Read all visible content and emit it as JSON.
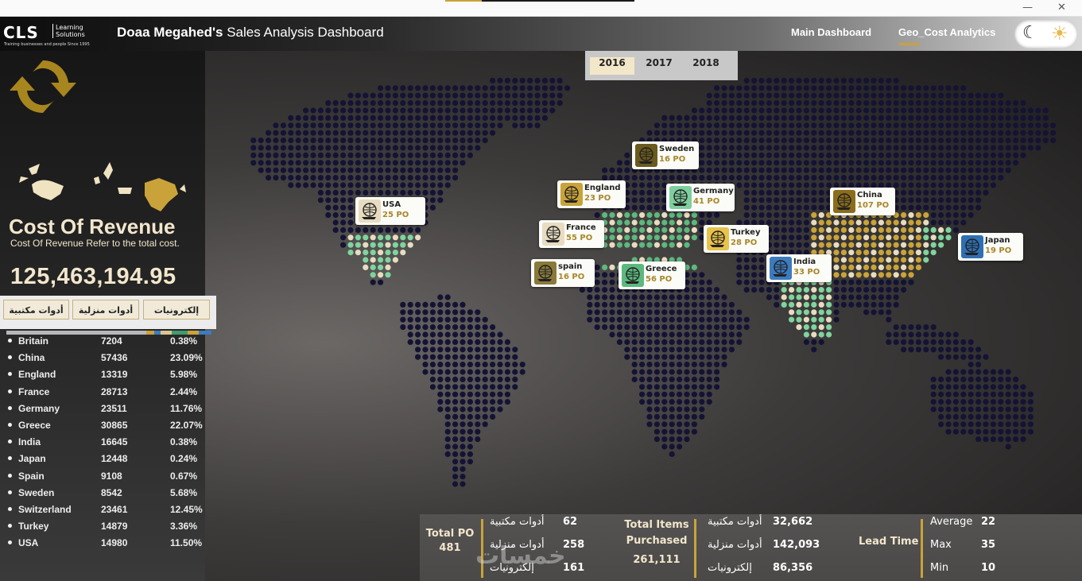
{
  "window": {
    "minimize": "—",
    "close": "✕"
  },
  "header": {
    "logo_text": "CLS",
    "logo_sub": "Learning Solutions",
    "logo_tagline": "Training businesses and people Since 1995",
    "title_owner": "Doaa Megahed's",
    "title_rest": " Sales Analysis Dashboard",
    "nav_main": "Main Dashboard",
    "nav_geo": "Geo_Cost Analytics"
  },
  "years": [
    "2016",
    "2017",
    "2018"
  ],
  "selected_year": "2016",
  "cost_of_revenue": {
    "title": "Cost Of Revenue",
    "subtitle": "Cost Of Revenue Refer to the total cost.",
    "value": "125,463,194.95"
  },
  "categories": [
    "أدوات مكتبية",
    "أدوات منزلية",
    "إلكترونيات"
  ],
  "category_strip_colors": [
    "#b7b7b7",
    "#c9a33a",
    "#3d7bbf",
    "#d8c58f",
    "#3f9b6d",
    "#c9a33a",
    "#3d7bbf"
  ],
  "table": [
    {
      "country": "Britain",
      "value": "7204",
      "pct": "0.38%"
    },
    {
      "country": "China",
      "value": "57436",
      "pct": "23.09%"
    },
    {
      "country": "England",
      "value": "13319",
      "pct": "5.98%"
    },
    {
      "country": "France",
      "value": "28713",
      "pct": "2.44%"
    },
    {
      "country": "Germany",
      "value": "23511",
      "pct": "11.76%"
    },
    {
      "country": "Greece",
      "value": "30865",
      "pct": "22.07%"
    },
    {
      "country": "India",
      "value": "16645",
      "pct": "0.38%"
    },
    {
      "country": "Japan",
      "value": "12448",
      "pct": "0.24%"
    },
    {
      "country": "Spain",
      "value": "9108",
      "pct": "0.67%"
    },
    {
      "country": "Sweden",
      "value": "8542",
      "pct": "5.68%"
    },
    {
      "country": "Switzerland",
      "value": "23461",
      "pct": "12.45%"
    },
    {
      "country": "Turkey",
      "value": "14879",
      "pct": "3.36%"
    },
    {
      "country": "USA",
      "value": "14980",
      "pct": "11.50%"
    }
  ],
  "markers": [
    {
      "name": "USA",
      "po": "25 PO",
      "color": "#e8dcc0"
    },
    {
      "name": "Sweden",
      "po": "16 PO",
      "color": "#6b5a1e"
    },
    {
      "name": "England",
      "po": "23 PO",
      "color": "#c9a33a"
    },
    {
      "name": "Germany",
      "po": "41 PO",
      "color": "#7fcf9e"
    },
    {
      "name": "France",
      "po": "55 PO",
      "color": "#e8dcc0"
    },
    {
      "name": "Turkey",
      "po": "28 PO",
      "color": "#e8c24a"
    },
    {
      "name": "spain",
      "po": "16 PO",
      "color": "#8a7a3a"
    },
    {
      "name": "Greece",
      "po": "56 PO",
      "color": "#5cb87e"
    },
    {
      "name": "China",
      "po": "107 PO",
      "color": "#8a6d1c"
    },
    {
      "name": "India",
      "po": "33 PO",
      "color": "#3d7bbf"
    },
    {
      "name": "Japan",
      "po": "19 PO",
      "color": "#2f6fb3"
    }
  ],
  "bottom": {
    "total_po_label": "Total PO",
    "total_po_value": "481",
    "po_rows": [
      {
        "label": "أدوات مكتبية",
        "value": "62"
      },
      {
        "label": "أدوات منزلية",
        "value": "258"
      },
      {
        "label": "إلكترونيات",
        "value": "161"
      }
    ],
    "items_label_1": "Total Items",
    "items_label_2": "Purchased",
    "items_value": "261,111",
    "items_rows": [
      {
        "label": "أدوات مكتبية",
        "value": "32,662"
      },
      {
        "label": "أدوات منزلية",
        "value": "142,093"
      },
      {
        "label": "إلكترونيات",
        "value": "86,356"
      }
    ],
    "lead_time_label": "Lead Time",
    "lead_rows": [
      {
        "label": "Average",
        "value": "22"
      },
      {
        "label": "Max",
        "value": "35"
      },
      {
        "label": "Min",
        "value": "10"
      }
    ]
  },
  "watermark": "خمسات"
}
